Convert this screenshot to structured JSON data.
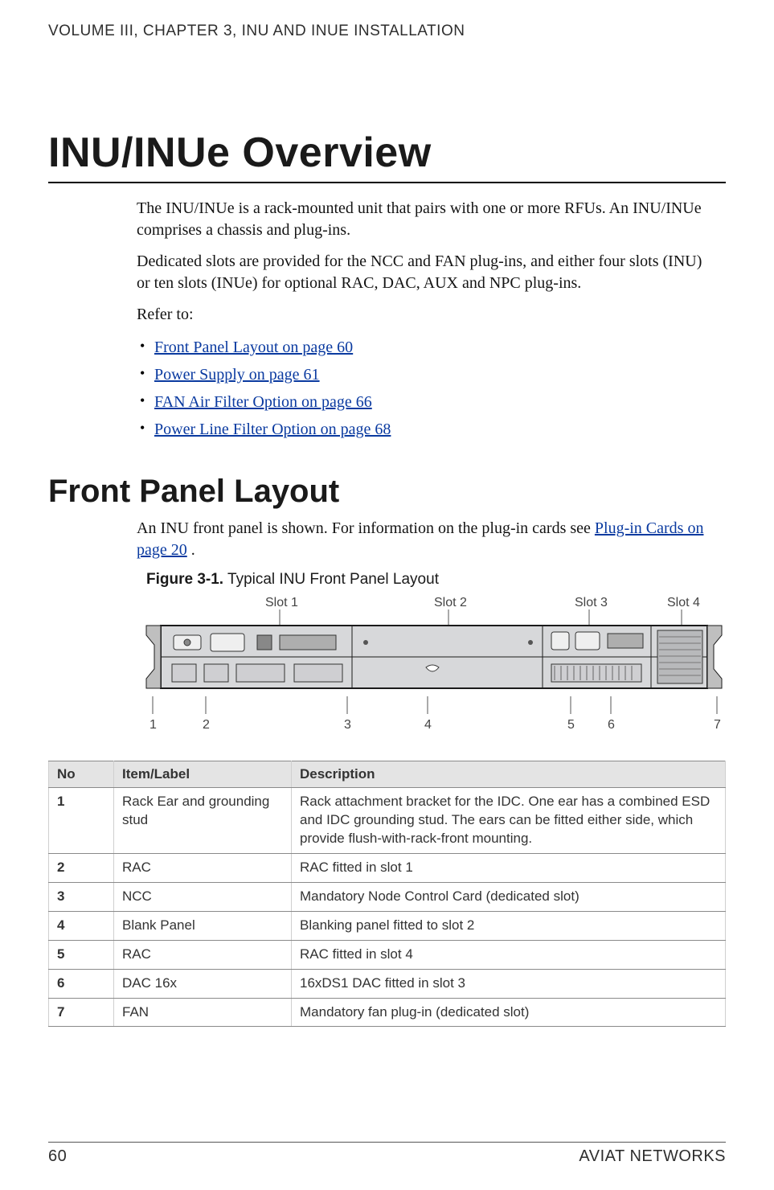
{
  "header": {
    "running_head": "VOLUME III, CHAPTER 3, INU AND INUE INSTALLATION"
  },
  "title": "INU/INUe Overview",
  "intro": {
    "p1": "The INU/INUe is a rack-mounted unit that pairs with one or more RFUs. An INU/INUe comprises a chassis and plug-ins.",
    "p2": "Dedicated slots are provided for the NCC and FAN plug-ins, and either four slots (INU) or ten slots (INUe) for optional RAC, DAC, AUX and NPC plug-ins.",
    "refer": "Refer to:",
    "links": {
      "l1": "Front Panel Layout on page 60",
      "l2": "Power Supply on page 61",
      "l3": "FAN Air Filter Option on page 66",
      "l4": "Power Line Filter Option on page 68"
    }
  },
  "section": {
    "heading": "Front Panel Layout",
    "p1_a": "An INU front panel is shown. For information on the plug-in cards see ",
    "p1_link": "Plug-in Cards on page 20",
    "p1_b": " .",
    "fig_label": "Figure 3-1.",
    "fig_title": " Typical INU Front Panel Layout",
    "slot_labels": {
      "s1": "Slot 1",
      "s2": "Slot 2",
      "s3": "Slot 3",
      "s4": "Slot 4"
    },
    "callouts": {
      "c1": "1",
      "c2": "2",
      "c3": "3",
      "c4": "4",
      "c5": "5",
      "c6": "6",
      "c7": "7"
    }
  },
  "table": {
    "headers": {
      "no": "No",
      "item": "Item/Label",
      "desc": "Description"
    },
    "rows": [
      {
        "no": "1",
        "item": "Rack Ear and grounding stud",
        "desc": "Rack attachment bracket for the IDC. One ear has a combined ESD and IDC grounding stud. The ears can be fitted either side, which provide flush-with-rack-front mounting."
      },
      {
        "no": "2",
        "item": "RAC",
        "desc": "RAC fitted in slot 1"
      },
      {
        "no": "3",
        "item": "NCC",
        "desc": "Mandatory Node Control Card (dedicated slot)"
      },
      {
        "no": "4",
        "item": "Blank Panel",
        "desc": "Blanking panel fitted to slot 2"
      },
      {
        "no": "5",
        "item": "RAC",
        "desc": "RAC fitted in slot 4"
      },
      {
        "no": "6",
        "item": "DAC 16x",
        "desc": "16xDS1 DAC fitted in slot 3"
      },
      {
        "no": "7",
        "item": "FAN",
        "desc": "Mandatory fan plug-in (dedicated slot)"
      }
    ]
  },
  "footer": {
    "page": "60",
    "org": "AVIAT NETWORKS"
  }
}
